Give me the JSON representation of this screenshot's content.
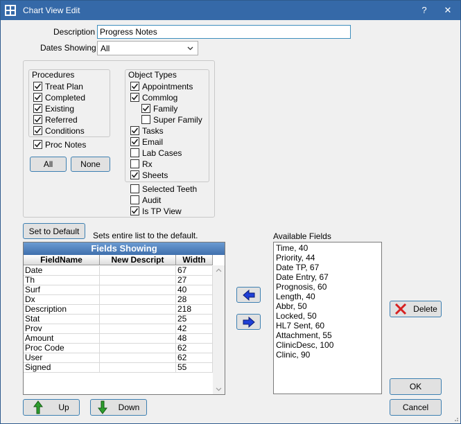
{
  "window": {
    "title": "Chart View Edit",
    "help_label": "?",
    "close_label": "✕"
  },
  "form": {
    "description_label": "Description",
    "description_value": "Progress Notes",
    "dates_label": "Dates Showing",
    "dates_value": "All"
  },
  "procedures": {
    "title": "Procedures",
    "items": [
      {
        "label": "Treat Plan",
        "checked": true
      },
      {
        "label": "Completed",
        "checked": true
      },
      {
        "label": "Existing",
        "checked": true
      },
      {
        "label": "Referred",
        "checked": true
      },
      {
        "label": "Conditions",
        "checked": true
      }
    ],
    "proc_notes": {
      "label": "Proc Notes",
      "checked": true
    },
    "all_button": "All",
    "none_button": "None"
  },
  "object_types": {
    "title": "Object Types",
    "items": [
      {
        "label": "Appointments",
        "checked": true
      },
      {
        "label": "Commlog",
        "checked": true
      },
      {
        "label": "Family",
        "checked": true
      },
      {
        "label": "Super Family",
        "checked": false
      },
      {
        "label": "Tasks",
        "checked": true
      },
      {
        "label": "Email",
        "checked": true
      },
      {
        "label": "Lab Cases",
        "checked": false
      },
      {
        "label": "Rx",
        "checked": false
      },
      {
        "label": "Sheets",
        "checked": true
      }
    ],
    "extra": [
      {
        "label": "Selected Teeth",
        "checked": false
      },
      {
        "label": "Audit",
        "checked": false
      },
      {
        "label": "Is TP View",
        "checked": true
      }
    ]
  },
  "defaults": {
    "button_label": "Set to Default",
    "hint": "Sets entire list to the default."
  },
  "fields_grid": {
    "title": "Fields Showing",
    "columns": [
      "FieldName",
      "New Descript",
      "Width"
    ],
    "rows": [
      [
        "Date",
        "",
        "67"
      ],
      [
        "Th",
        "",
        "27"
      ],
      [
        "Surf",
        "",
        "40"
      ],
      [
        "Dx",
        "",
        "28"
      ],
      [
        "Description",
        "",
        "218"
      ],
      [
        "Stat",
        "",
        "25"
      ],
      [
        "Prov",
        "",
        "42"
      ],
      [
        "Amount",
        "",
        "48"
      ],
      [
        "Proc Code",
        "",
        "62"
      ],
      [
        "User",
        "",
        "62"
      ],
      [
        "Signed",
        "",
        "55"
      ]
    ]
  },
  "available": {
    "label": "Available Fields",
    "items": [
      "Time, 40",
      "Priority, 44",
      "Date TP, 67",
      "Date Entry, 67",
      "Prognosis, 60",
      "Length, 40",
      "Abbr, 50",
      "Locked, 50",
      "HL7 Sent, 60",
      "Attachment, 55",
      "ClinicDesc, 100",
      "Clinic, 90"
    ]
  },
  "buttons": {
    "delete": "Delete",
    "ok": "OK",
    "cancel": "Cancel",
    "up": "Up",
    "down": "Down"
  },
  "colors": {
    "titlebar": "#3569a8",
    "accent_border": "#3c7fb1",
    "arrow_blue": "#1f3fd6",
    "arrow_green": "#2e9e2e",
    "delete_red": "#d62020"
  }
}
